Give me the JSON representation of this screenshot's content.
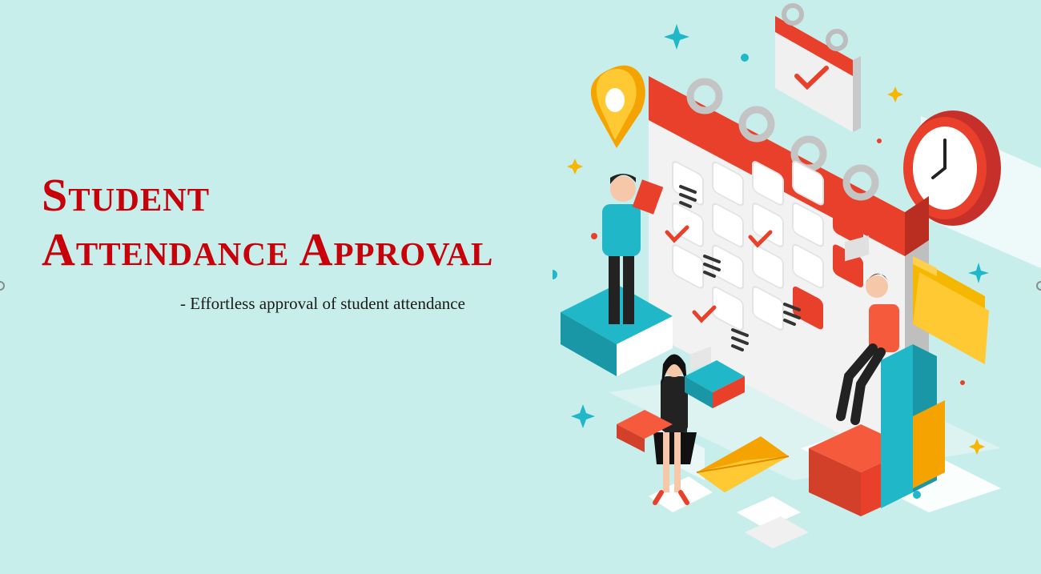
{
  "hero": {
    "title_line1": "Student",
    "title_line2": "Attendance Approval",
    "subtitle": "- Effortless approval of student attendance"
  },
  "colors": {
    "background": "#c7eeeb",
    "title": "#c8000a",
    "accent_red": "#e8402a",
    "accent_teal": "#20b8c8",
    "accent_yellow": "#f5b700"
  },
  "illustration": {
    "icons": [
      "calendar-icon",
      "clock-icon",
      "location-pin-icon",
      "folder-icon",
      "envelope-icon",
      "checkmark-icon"
    ]
  }
}
